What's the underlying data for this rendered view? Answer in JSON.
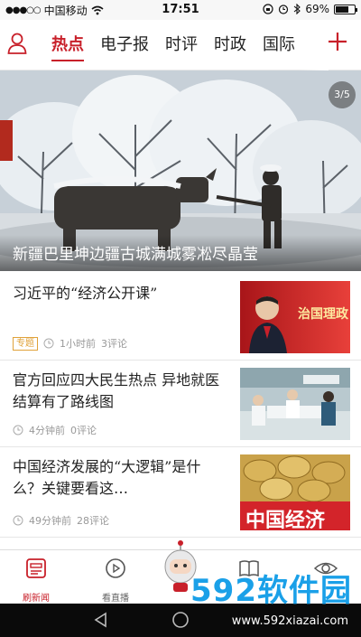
{
  "status_bar": {
    "carrier": "中国移动",
    "time": "17:51",
    "battery": "69%",
    "battery_level": 0.69
  },
  "top_nav": {
    "tabs": [
      {
        "label": "热点",
        "active": true
      },
      {
        "label": "电子报",
        "active": false
      },
      {
        "label": "时评",
        "active": false
      },
      {
        "label": "时政",
        "active": false
      },
      {
        "label": "国际",
        "active": false
      }
    ]
  },
  "hero": {
    "counter": "3/5",
    "caption": "新疆巴里坤边疆古城满城雾凇尽晶莹"
  },
  "articles": [
    {
      "title": "习近平的“经济公开课”",
      "badge": "专题",
      "time": "1小时前",
      "comments": "3评论",
      "thumb_text": "治国理政"
    },
    {
      "title": "官方回应四大民生热点 异地就医结算有了路线图",
      "badge": "",
      "time": "4分钟前",
      "comments": "0评论",
      "thumb_text": ""
    },
    {
      "title": "中国经济发展的“大逻辑”是什么？关键要看这…",
      "badge": "",
      "time": "49分钟前",
      "comments": "28评论",
      "thumb_text": "中国经济"
    }
  ],
  "bottom_tabs": [
    {
      "label": "刷新闻",
      "icon": "news-icon",
      "active": true
    },
    {
      "label": "看直播",
      "icon": "play-icon",
      "active": false
    },
    {
      "label": "",
      "icon": "robot-avatar-icon",
      "active": false
    },
    {
      "label": "",
      "icon": "book-icon",
      "active": false
    },
    {
      "label": "",
      "icon": "eye-icon",
      "active": false
    }
  ],
  "watermark": {
    "brand": "592软件园",
    "url": "www.592xiazai.com"
  }
}
